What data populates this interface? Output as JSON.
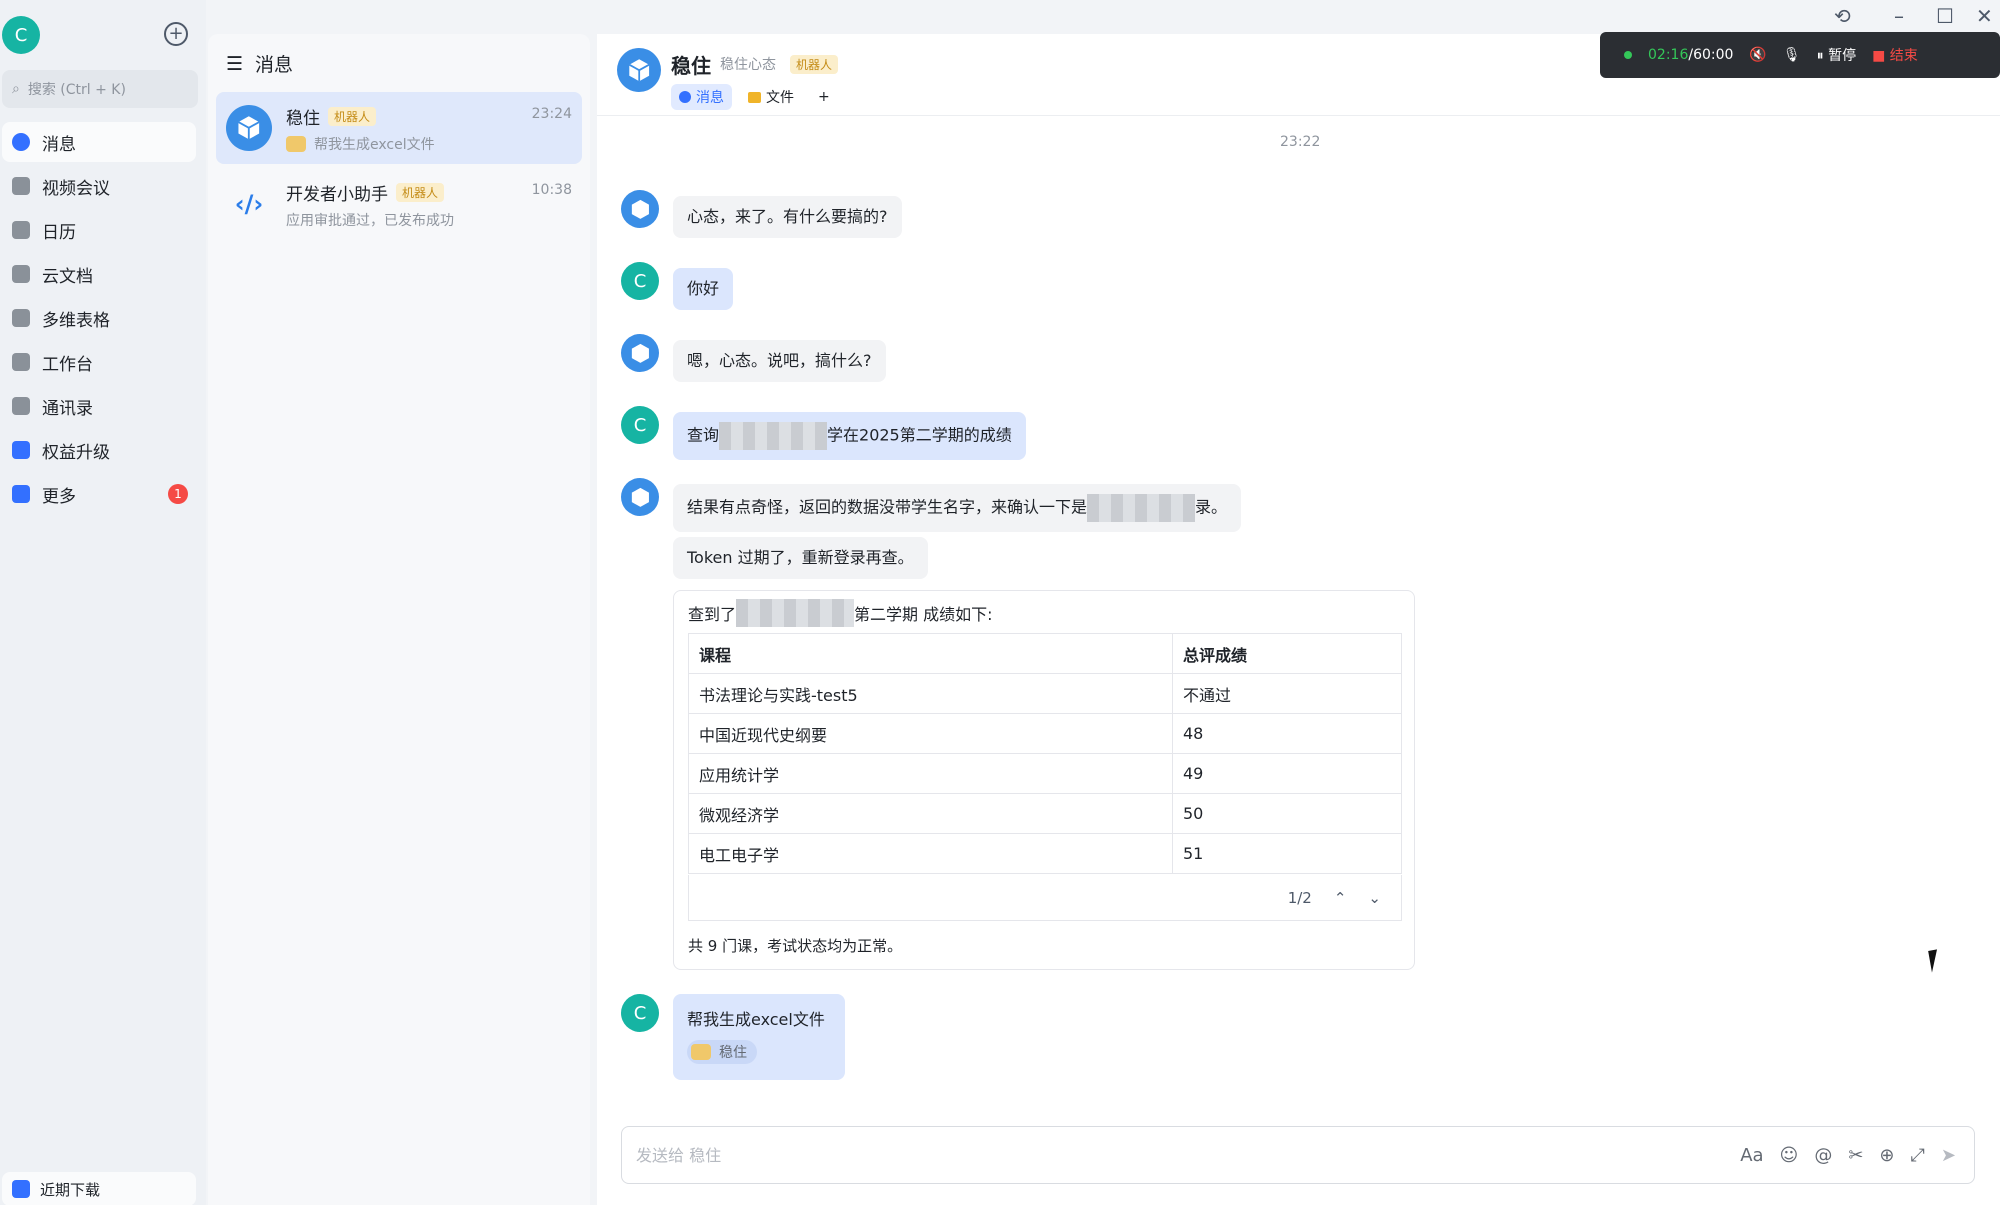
{
  "user_initial": "C",
  "nav": {
    "search_placeholder": "搜索 (Ctrl + K)",
    "items": [
      {
        "label": "消息",
        "icon": "chat-icon",
        "active": true
      },
      {
        "label": "视频会议",
        "icon": "video-icon"
      },
      {
        "label": "日历",
        "icon": "calendar-icon"
      },
      {
        "label": "云文档",
        "icon": "doc-icon"
      },
      {
        "label": "多维表格",
        "icon": "base-icon"
      },
      {
        "label": "工作台",
        "icon": "grid-icon"
      },
      {
        "label": "通讯录",
        "icon": "contacts-icon"
      },
      {
        "label": "权益升级",
        "icon": "diamond-icon"
      },
      {
        "label": "更多",
        "icon": "more-icon",
        "badge": "1"
      }
    ],
    "downloads": "近期下载"
  },
  "conversations": {
    "header": "消息",
    "items": [
      {
        "name": "稳住",
        "tag": "机器人",
        "time": "23:24",
        "preview": "帮我生成excel文件",
        "active": true
      },
      {
        "name": "开发者小助手",
        "tag": "机器人",
        "time": "10:38",
        "preview": "应用审批通过，已发布成功"
      }
    ]
  },
  "chat": {
    "title": "稳住",
    "subtitle": "稳住心态",
    "tag": "机器人",
    "tabs": [
      "消息",
      "文件"
    ],
    "add": "+",
    "timestamp": "23:22",
    "messages": [
      {
        "from": "bot",
        "text": "心态，来了。有什么要搞的?"
      },
      {
        "from": "user",
        "text": "你好"
      },
      {
        "from": "bot",
        "text": "嗯，心态。说吧，搞什么?"
      },
      {
        "from": "user",
        "pre": "查询",
        "post": "学在2025第二学期的成绩"
      },
      {
        "from": "bot",
        "pre": "结果有点奇怪，返回的数据没带学生名字，来确认一下是",
        "post": "录。"
      },
      {
        "from": "bot",
        "text": "Token 过期了，重新登录再查。"
      }
    ],
    "card": {
      "pre": "查到了",
      "post": "第二学期 成绩如下:",
      "headers": [
        "课程",
        "总评成绩"
      ],
      "rows": [
        [
          "书法理论与实践-test5",
          "不通过"
        ],
        [
          "中国近现代史纲要",
          "48"
        ],
        [
          "应用统计学",
          "49"
        ],
        [
          "微观经济学",
          "50"
        ],
        [
          "电工电子学",
          "51"
        ]
      ],
      "pager": "1/2",
      "footer": "共 9 门课，考试状态均为正常。"
    },
    "last_user": {
      "text": "帮我生成excel文件",
      "quote": "稳住"
    },
    "input_placeholder": "发送给 稳住"
  },
  "recording": {
    "elapsed": "02:16",
    "limit": "/60:00",
    "pause": "暂停",
    "end": "结束"
  }
}
